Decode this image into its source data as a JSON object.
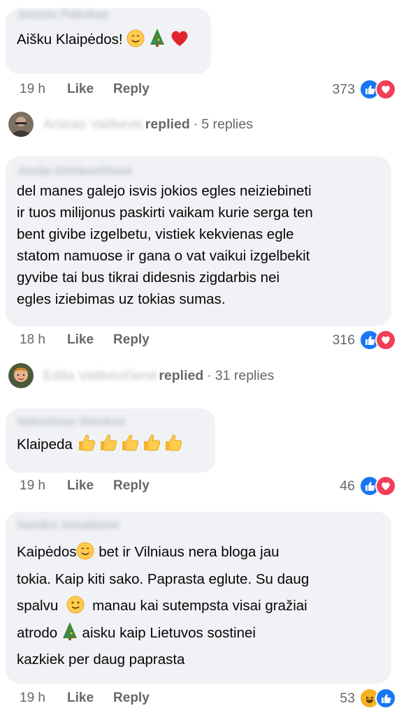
{
  "comments": [
    {
      "name": "Juozas Paliukas",
      "text": "Aišku Klaipėdos!",
      "time": "19 h",
      "like_label": "Like",
      "reply_label": "Reply",
      "reaction_count": "373",
      "reactions": [
        "like-icon",
        "love-icon"
      ],
      "replies": {
        "name": "Arūnas Vaitkevic",
        "label": "replied",
        "count": "5 replies"
      }
    },
    {
      "name": "Jovita Grinkevičienė",
      "lines": [
        "del manes galejo isvis jokios egles neiziebineti",
        "ir tuos milijonus paskirti vaikam kurie serga ten",
        "bent givibe izgelbetu, vistiek kekvienas egle",
        "statom namuose ir gana o vat vaikui izgelbekit",
        "gyvibe tai bus tikrai didesnis zigdarbis nei",
        "egles iziebimas uz tokias sumas."
      ],
      "time": "18 h",
      "like_label": "Like",
      "reply_label": "Reply",
      "reaction_count": "316",
      "reactions": [
        "like-icon",
        "love-icon"
      ],
      "replies": {
        "name": "Edita Vaitkevičienė",
        "label": "replied",
        "count": "31 replies"
      }
    },
    {
      "name": "Valentinas Stonkus",
      "text": "Klaipeda",
      "time": "19 h",
      "like_label": "Like",
      "reply_label": "Reply",
      "reaction_count": "46",
      "reactions": [
        "like-icon",
        "love-icon"
      ]
    },
    {
      "name": "Sandra Jonaitienė",
      "lines": [
        "Kaipėdos",
        "bet ir Vilniaus nera bloga jau",
        "tokia. Kaip kiti sako.  Paprasta eglute.  Su daug",
        "spalvu",
        "manau kai sutempsta  visai gražiai",
        "atrodo",
        "aisku kaip  Lietuvos sostinei",
        "kazkiek   per daug paprasta"
      ],
      "time": "19 h",
      "like_label": "Like",
      "reply_label": "Reply",
      "reaction_count": "53",
      "reactions": [
        "haha-icon",
        "like-icon"
      ]
    }
  ],
  "colors": {
    "like": "#1877f2",
    "love": "#f33e58",
    "haha": "#f7b125",
    "bubble": "#f0f2f5",
    "meta": "#65676b"
  }
}
